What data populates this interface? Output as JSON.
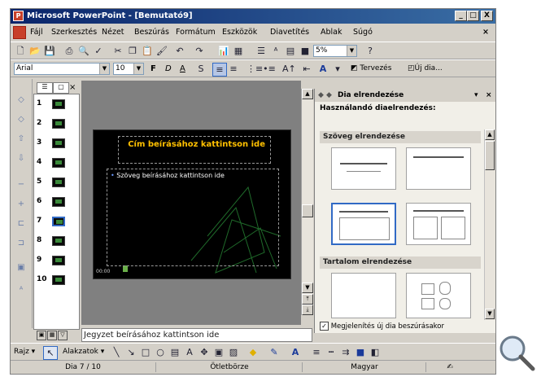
{
  "window": {
    "title": "Microsoft PowerPoint - [Bemutató9]",
    "controls": {
      "minimize": "_",
      "maximize": "□",
      "close": "X"
    }
  },
  "menu": [
    "Fájl",
    "Szerkesztés",
    "Nézet",
    "Beszúrás",
    "Formátum",
    "Eszközök",
    "Diavetítés",
    "Ablak",
    "Súgó"
  ],
  "standard_toolbar": {
    "zoom": "5%"
  },
  "formatting_toolbar": {
    "font": "Arial",
    "size": "10",
    "bold": "F",
    "italic": "D",
    "underline": "A",
    "design_label": "Tervezés",
    "new_slide_label": "Új dia..."
  },
  "thumbnails": [
    "1",
    "2",
    "3",
    "4",
    "5",
    "6",
    "7",
    "8",
    "9",
    "10"
  ],
  "slide": {
    "title_placeholder": "Cím beírásához kattintson ide",
    "body_placeholder": "Szöveg beírásához kattintson ide",
    "footer_text": "00:00"
  },
  "notes_placeholder": "Jegyzet beírásához kattintson ide",
  "task_pane": {
    "title": "Dia elrendezése",
    "subtitle": "Használandó diaelrendezés:",
    "section_text": "Szöveg elrendezése",
    "section_content": "Tartalom elrendezése",
    "checkbox_label": "Megjelenítés új dia beszúrásakor"
  },
  "drawing_toolbar": {
    "draw_label": "Rajz",
    "autoshapes_label": "Alakzatok"
  },
  "status_bar": {
    "slide_pos": "Dia 7 / 10",
    "design": "Ötletbörze",
    "language": "Magyar"
  }
}
